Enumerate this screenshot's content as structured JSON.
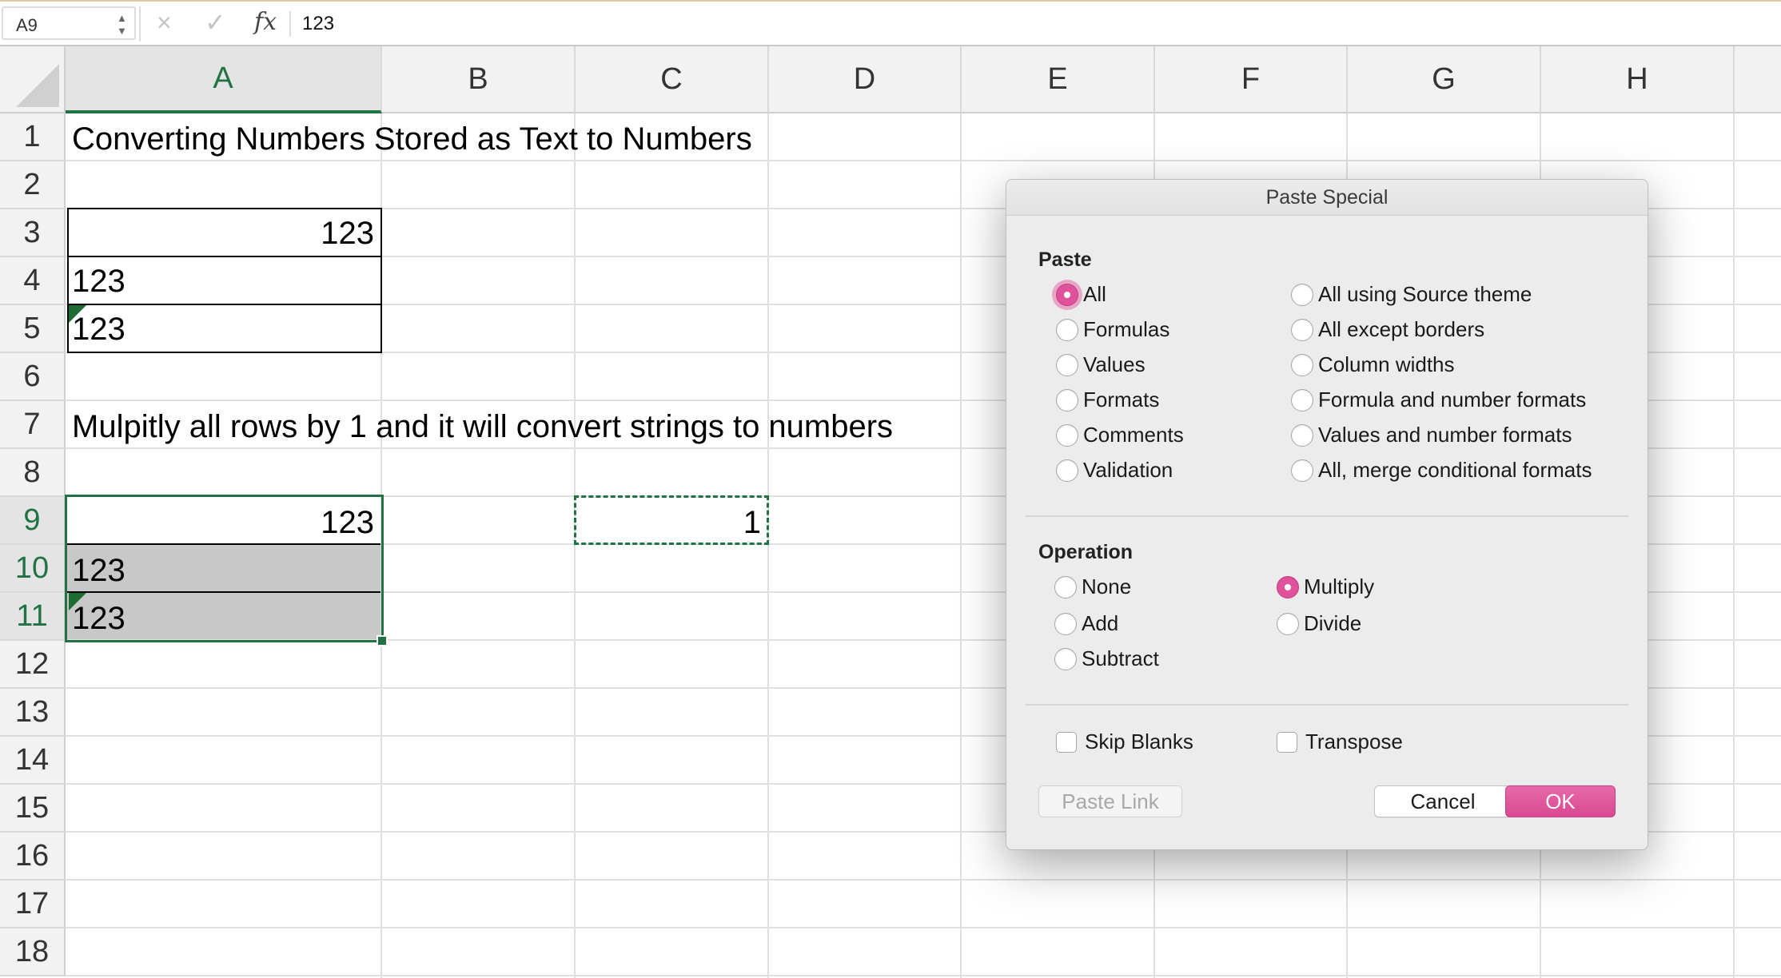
{
  "formula_bar": {
    "name_box": "A9",
    "cancel_icon": "×",
    "enter_icon": "✓",
    "fx_label": "fx",
    "formula": "123"
  },
  "grid": {
    "columns": [
      "A",
      "B",
      "C",
      "D",
      "E",
      "F",
      "G",
      "H"
    ],
    "rows": [
      "1",
      "2",
      "3",
      "4",
      "5",
      "6",
      "7",
      "8",
      "9",
      "10",
      "11",
      "12",
      "13",
      "14",
      "15",
      "16",
      "17",
      "18"
    ],
    "selected_column": "A",
    "selected_rows": [
      "9",
      "10",
      "11"
    ]
  },
  "cells": {
    "A1": "Converting Numbers Stored as Text to Numbers",
    "A3": "123",
    "A4": "123",
    "A5": "123",
    "A7": "Mulpitly all rows by 1 and it will convert strings to numbers",
    "A9": "123",
    "A10": "123",
    "A11": "123",
    "C9": "1"
  },
  "dialog": {
    "title": "Paste Special",
    "paste_label": "Paste",
    "paste_options_left": [
      "All",
      "Formulas",
      "Values",
      "Formats",
      "Comments",
      "Validation"
    ],
    "paste_options_right": [
      "All using Source theme",
      "All except borders",
      "Column widths",
      "Formula and number formats",
      "Values and number formats",
      "All, merge conditional formats"
    ],
    "paste_selected": "All",
    "operation_label": "Operation",
    "operation_left": [
      "None",
      "Add",
      "Subtract"
    ],
    "operation_right": [
      "Multiply",
      "Divide"
    ],
    "operation_selected": "Multiply",
    "skip_blanks": "Skip Blanks",
    "transpose": "Transpose",
    "paste_link": "Paste Link",
    "cancel": "Cancel",
    "ok": "OK"
  },
  "colors": {
    "accent_green": "#217346",
    "accent_pink": "#e0529c"
  }
}
